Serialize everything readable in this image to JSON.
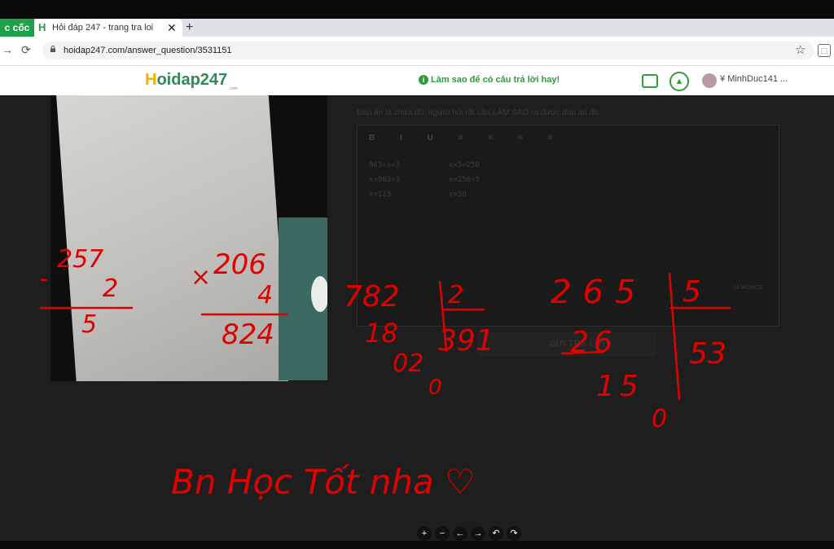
{
  "browser": {
    "brand": "c cốc",
    "tab_title": "Hỏi đáp 247 - trang tra loi",
    "tab_close": "✕",
    "new_tab": "+",
    "url": "hoidap247.com/answer_question/3531151",
    "accent": "#1fa04a"
  },
  "site": {
    "logo_text": "oidap247",
    "logo_h": "H",
    "logo_com": ".com",
    "tip": "Làm sao để có câu trả lời hay!",
    "username": "MinhDuc141 ...",
    "brand_color": "#2e8b57"
  },
  "editor": {
    "hint": "Đáp án là chưa đủ, người hỏi rất cần LÀM SAO ra được đáp án đó.",
    "toolbar": "B I U ≡ ≡ ≡ ≡",
    "left_lines": [
      "963÷x=3",
      "x=963÷3",
      "x=123"
    ],
    "right_lines": [
      "x×5=250",
      "x=250÷5",
      "x=50"
    ],
    "word_count": "14 WORDS",
    "submit_label": "GỬI TRẢ LỜI"
  },
  "ink": {
    "color": "#e00000",
    "calc1": {
      "op": "-",
      "top": "257",
      "bottom": "2",
      "result": "5"
    },
    "calc2": {
      "op": "×",
      "top": "206",
      "bottom": "4",
      "result": "824"
    },
    "calc3": {
      "dividend": "782",
      "divisor": "2",
      "quotient": "391",
      "steps": [
        "18",
        "02",
        "0"
      ]
    },
    "calc4": {
      "dividend": "265",
      "divisor": "5",
      "quotient": "53",
      "steps": [
        "26",
        "15",
        "0"
      ]
    },
    "message": "Bn Học Tốt nha ♡"
  },
  "controls": [
    "+",
    "−",
    "←",
    "→",
    "↶",
    "↷"
  ]
}
